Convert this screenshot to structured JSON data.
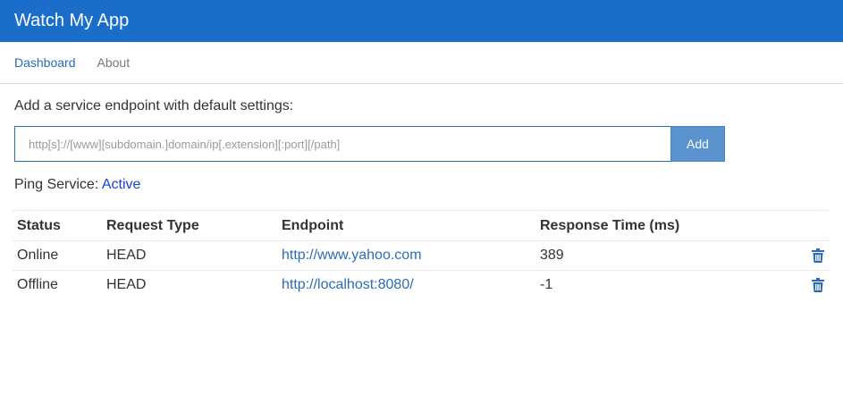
{
  "app": {
    "title": "Watch My App"
  },
  "nav": {
    "items": [
      {
        "label": "Dashboard",
        "active": true
      },
      {
        "label": "About",
        "active": false
      }
    ]
  },
  "add_form": {
    "label": "Add a service endpoint with default settings:",
    "placeholder": "http[s]://[www][subdomain.]domain/ip[.extension][:port][/path]",
    "value": "",
    "button_label": "Add"
  },
  "ping": {
    "label": "Ping Service:",
    "status": "Active"
  },
  "table": {
    "headers": [
      "Status",
      "Request Type",
      "Endpoint",
      "Response Time (ms)",
      ""
    ],
    "rows": [
      {
        "status": "Online",
        "request_type": "HEAD",
        "endpoint": "http://www.yahoo.com",
        "response_time": "389",
        "delete_icon": "trash-icon"
      },
      {
        "status": "Offline",
        "request_type": "HEAD",
        "endpoint": "http://localhost:8080/",
        "response_time": "-1",
        "delete_icon": "trash-icon"
      }
    ]
  },
  "colors": {
    "header_bg": "#1a6ec9",
    "link": "#2a6db5",
    "online": "#228b22",
    "offline": "#e0161c",
    "ping_active": "#1b3fd6",
    "add_button": "#5b93cf"
  }
}
